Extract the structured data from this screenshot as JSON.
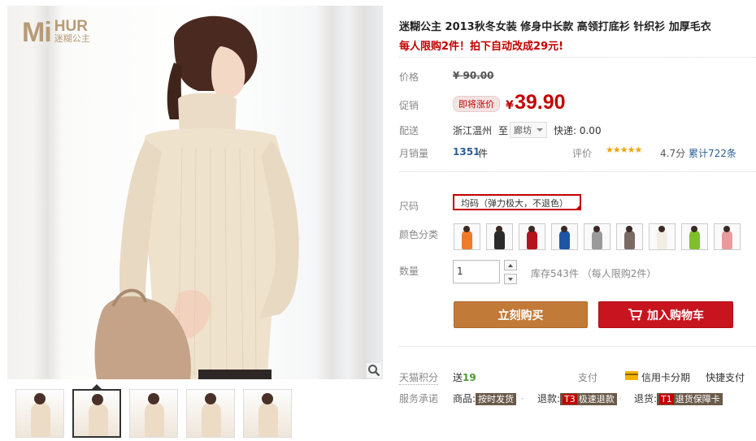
{
  "brand": {
    "mark": "Mi",
    "name_en": "HUR",
    "name_cn": "迷糊公主"
  },
  "product": {
    "title": "迷糊公主 2013秋冬女装 修身中长款 高领打底衫 针织衫 加厚毛衣",
    "subtitle": "每人限购2件！拍下自动改成29元!"
  },
  "price": {
    "label": "价格",
    "original": "¥ 90.00",
    "promo_label": "促销",
    "promo_badge": "即将涨价",
    "currency": "¥",
    "current": "39.90"
  },
  "shipping": {
    "label": "配送",
    "from": "浙江温州",
    "to_label": "至",
    "to_value": "廊坊",
    "fee": "快递: 0.00"
  },
  "sales": {
    "label": "月销量",
    "count": "1351",
    "unit": "件",
    "rating_label": "评价",
    "stars": "★★★★★",
    "rating_score": "4.7分",
    "review_count": "累计722条"
  },
  "options": {
    "size_label": "尺码",
    "size_value": "均码（弹力极大，不退色）",
    "color_label": "颜色分类",
    "colors": [
      "#f07a2a",
      "#2b2b2b",
      "#b4141e",
      "#1e55a6",
      "#9a9a9a",
      "#7a6a66",
      "#f2ede4",
      "#7fbf2a",
      "#e99b9b"
    ],
    "qty_label": "数量",
    "qty_value": "1",
    "stock": "库存543件  （每人限购2件）"
  },
  "actions": {
    "buy": "立刻购买",
    "cart": "加入购物车"
  },
  "service": {
    "points_label": "天猫积分",
    "points_prefix": "送",
    "points_value": "19",
    "pay_label": "支付",
    "card_label": "信用卡分期",
    "quickpay": "快捷支付",
    "promise_label": "服务承诺",
    "promise_goods": "商品:",
    "promise_goods_tag": "按时发货",
    "promise_refund": "退款:",
    "promise_refund_code": "T3",
    "promise_refund_tag": "极速退款",
    "promise_return": "退货:",
    "promise_return_code": "T1",
    "promise_return_tag": "退货保障卡"
  },
  "thumbnails": [
    "thumb-1",
    "thumb-2",
    "thumb-3",
    "thumb-4",
    "thumb-5"
  ],
  "colors": {
    "accent_red": "#c40000",
    "buy_button": "#c17a38",
    "cart_button": "#c8141e",
    "link_blue": "#2a5e96"
  }
}
